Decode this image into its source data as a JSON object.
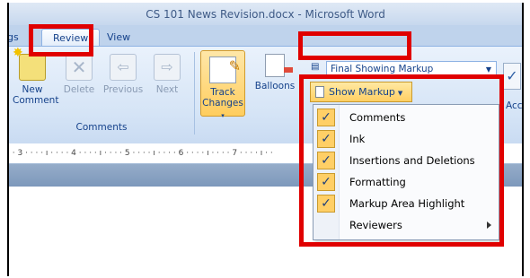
{
  "window": {
    "title": "CS 101 News Revision.docx - Microsoft Word"
  },
  "tabs": {
    "cut_left": "gs",
    "review": "Review",
    "view": "View"
  },
  "ribbon": {
    "comments_group": {
      "new_comment": "New\nComment",
      "delete": "Delete",
      "previous": "Previous",
      "next": "Next",
      "label": "Comments"
    },
    "tracking_group": {
      "track_changes": "Track\nChanges",
      "balloons": "Balloons",
      "display_combo": "Final Showing Markup",
      "show_markup": "Show Markup"
    },
    "accept_label": "Acc"
  },
  "ruler": {
    "text": "· · 3 · · · · ı · · · · 4 · · · · ı · · · · 5 · · · · ı · · · · 6 · · · · ı · · · · 7 · · · · ı · ·"
  },
  "menu": {
    "items": [
      {
        "label": "Comments",
        "checked": true
      },
      {
        "label": "Ink",
        "checked": true
      },
      {
        "label": "Insertions and Deletions",
        "checked": true
      },
      {
        "label": "Formatting",
        "checked": true
      },
      {
        "label": "Markup Area Highlight",
        "checked": true
      },
      {
        "label": "Reviewers",
        "checked": false,
        "submenu": true
      }
    ]
  },
  "highlight_color": "#e00000",
  "accent_color": "#ffcf63"
}
